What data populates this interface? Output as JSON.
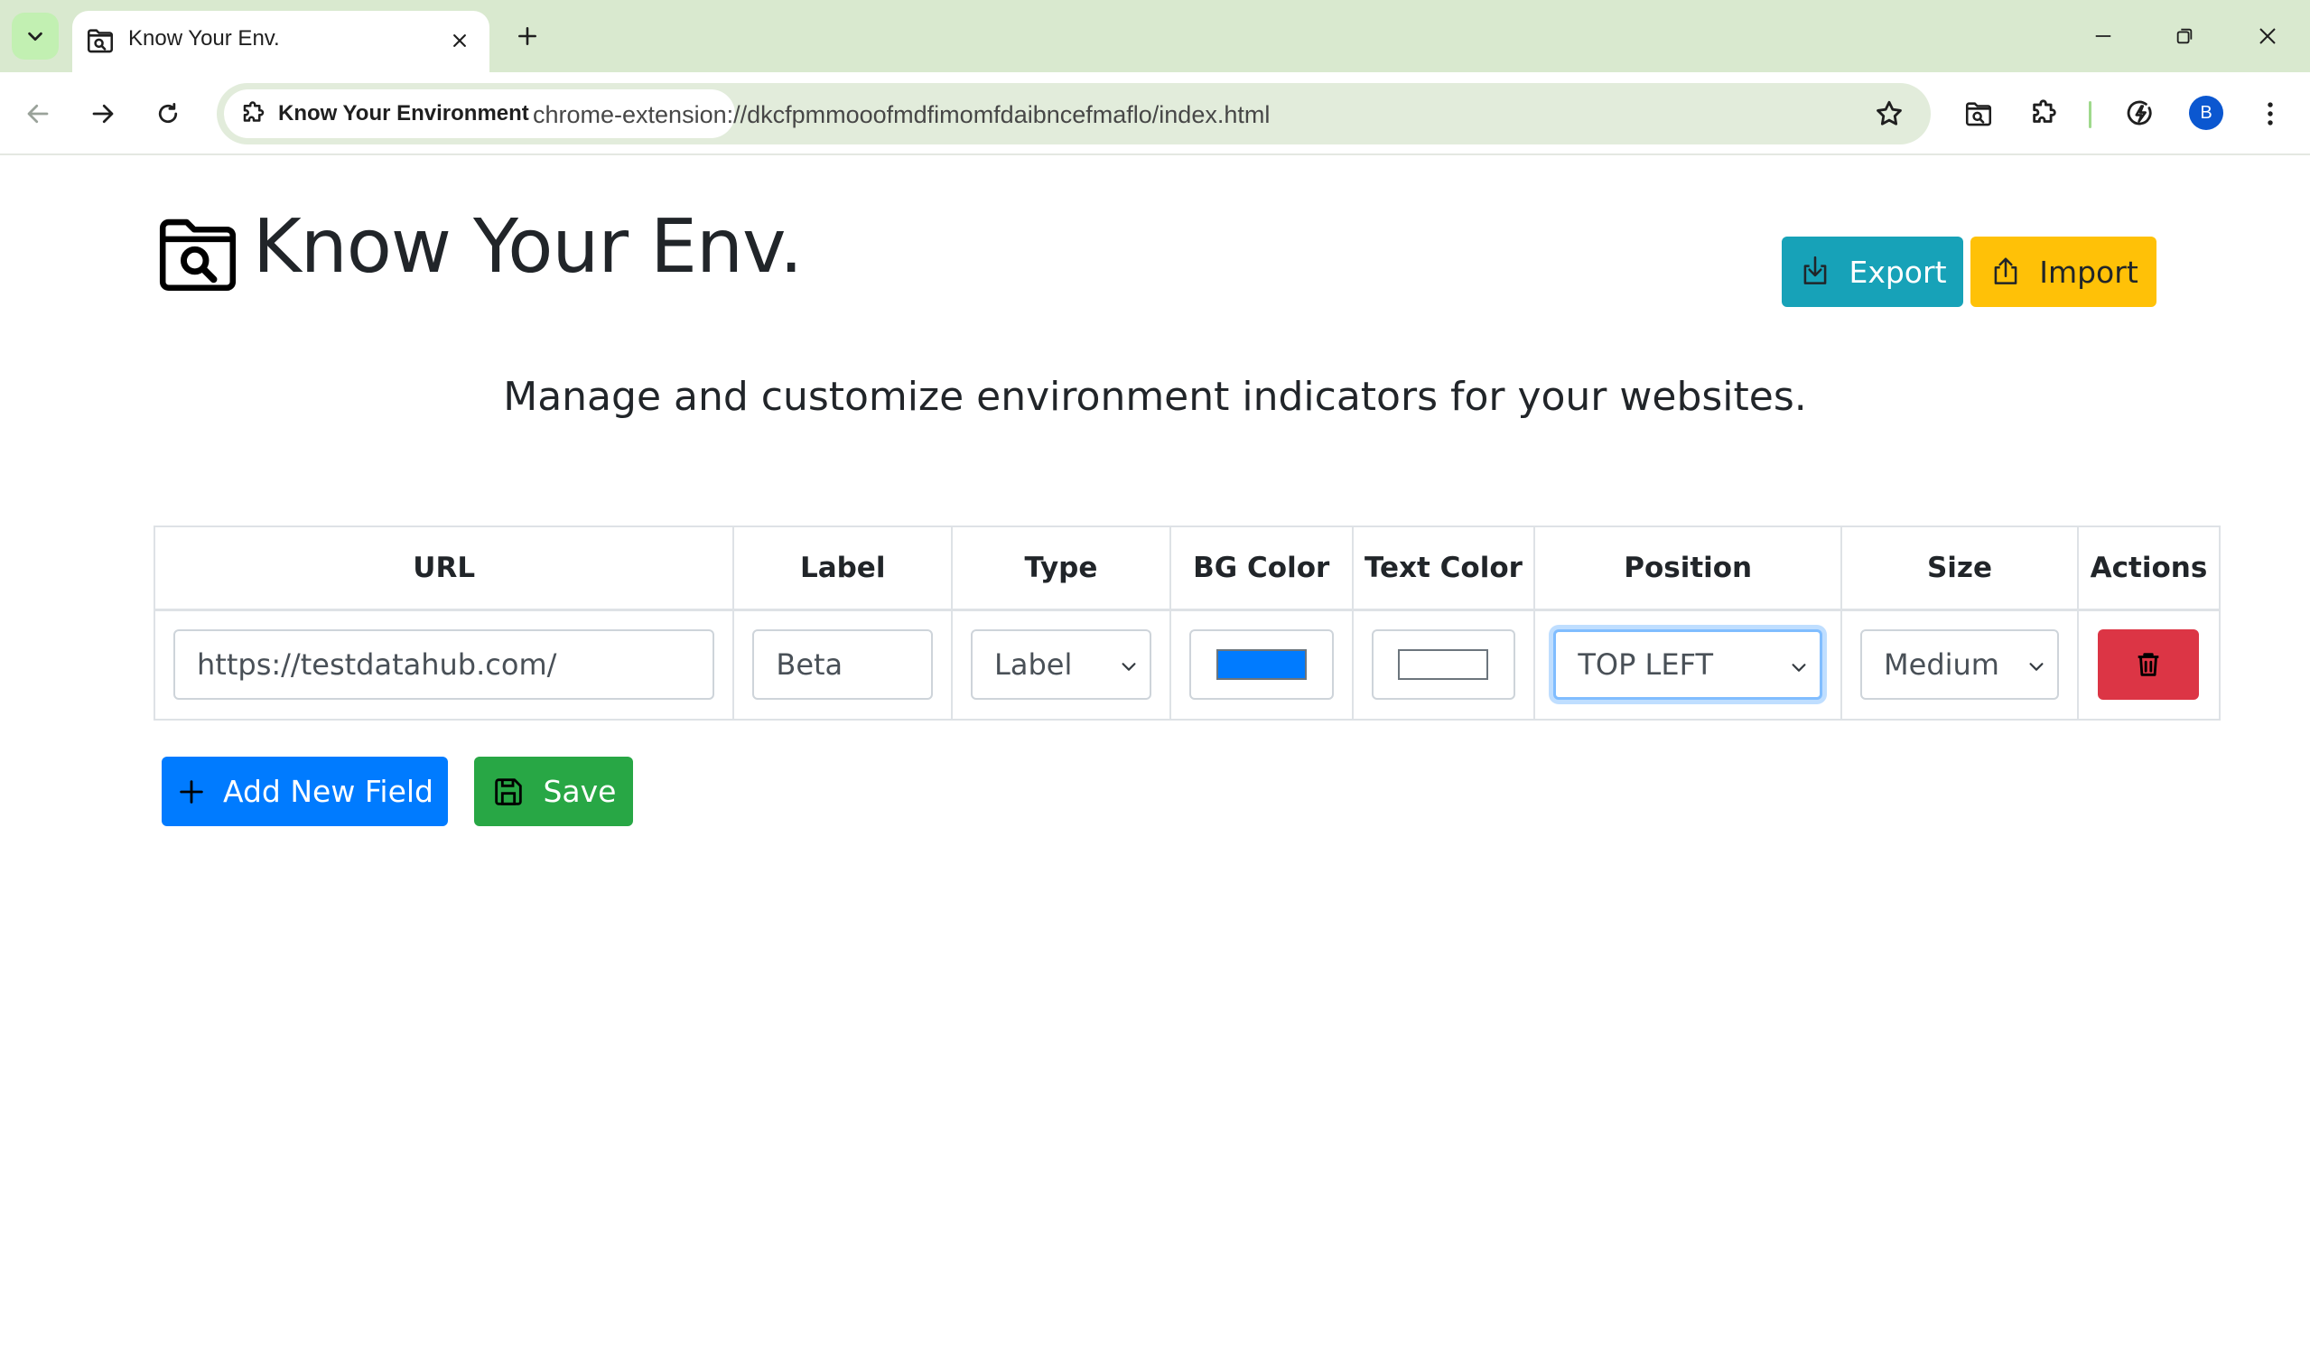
{
  "browser": {
    "tab_title": "Know Your Env.",
    "site_chip_label": "Know Your Environment",
    "url": "chrome-extension://dkcfpmmooofmdfimomfdaibncefmaflo/index.html",
    "profile_initial": "B",
    "icons": {
      "tab_search": "chevron-down-icon",
      "favicon": "folder-search-icon",
      "close": "close-icon",
      "new_tab": "plus-icon",
      "back": "arrow-left-icon",
      "forward": "arrow-right-icon",
      "reload": "reload-icon",
      "bookmark": "star-icon",
      "extension_app": "folder-search-icon",
      "extensions": "puzzle-icon",
      "performance": "lightning-circle-icon",
      "menu": "kebab-menu-icon",
      "minimize": "minimize-icon",
      "restore": "restore-icon",
      "window_close": "close-icon"
    }
  },
  "header": {
    "brand": "Know Your Env.",
    "export_label": "Export",
    "import_label": "Import",
    "subtitle": "Manage and customize environment indicators for your websites."
  },
  "table": {
    "columns": [
      "URL",
      "Label",
      "Type",
      "BG Color",
      "Text Color",
      "Position",
      "Size",
      "Actions"
    ],
    "rows": [
      {
        "url": "https://testdatahub.com/",
        "label": "Beta",
        "type": "Label",
        "bg_color": "#007bff",
        "text_color": "#ffffff",
        "position": "TOP LEFT",
        "size": "Medium"
      }
    ]
  },
  "actions": {
    "add_label": "Add New Field",
    "save_label": "Save"
  },
  "colors": {
    "export": "#17a2b8",
    "import": "#ffc107",
    "add": "#007bff",
    "save": "#28a745",
    "delete": "#dc3545"
  }
}
